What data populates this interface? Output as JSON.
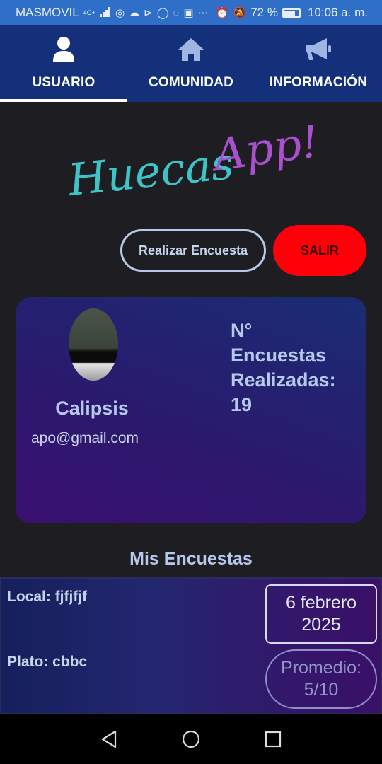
{
  "status_bar": {
    "carrier": "MASMOVIL",
    "network": "4G+",
    "battery": "72 %",
    "time": "10:06 a. m."
  },
  "nav": {
    "tabs": [
      {
        "label": "USUARIO",
        "icon": "user-icon",
        "active": true
      },
      {
        "label": "COMUNIDAD",
        "icon": "home-icon",
        "active": false
      },
      {
        "label": "INFORMACIÓN",
        "icon": "megaphone-icon",
        "active": false
      }
    ]
  },
  "logo": {
    "part1": "Huecas",
    "part2": "App!"
  },
  "actions": {
    "survey_label": "Realizar Encuesta",
    "exit_label": "SALIR"
  },
  "profile": {
    "name": "Calipsis",
    "email": "apo@gmail.com",
    "stats_line1": "N°",
    "stats_line2": "Encuestas",
    "stats_line3": "Realizadas:",
    "stats_count": "19"
  },
  "my_surveys": {
    "title": "Mis Encuestas",
    "items": [
      {
        "local": "Local: fjfjfjf",
        "plato": "Plato: cbbc",
        "date_line1": "6 febrero",
        "date_line2": "2025",
        "avg_line1": "Promedio:",
        "avg_line2": "5/10"
      }
    ]
  },
  "colors": {
    "status_bar": "#2f6fc7",
    "nav": "#14307a",
    "exit_button": "#ff0008",
    "logo_teal": "#3cc4c6",
    "logo_purple": "#a94fd0"
  }
}
